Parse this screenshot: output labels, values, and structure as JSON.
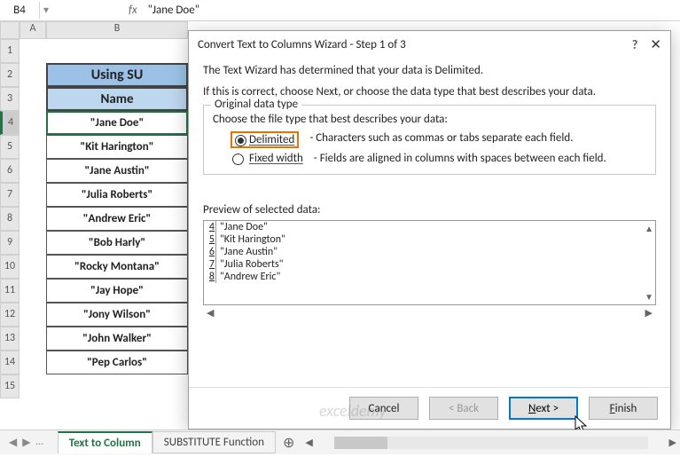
{
  "formula_bar": {
    "name_box": "B4",
    "dropdown_glyph": "▾",
    "fx_label": "fx",
    "formula_text": "\"Jane Doe\""
  },
  "columns": {
    "A": "A",
    "B": "B"
  },
  "rows": [
    "1",
    "2",
    "3",
    "4",
    "5",
    "6",
    "7",
    "8",
    "9",
    "10",
    "11",
    "12",
    "13",
    "14",
    "15"
  ],
  "table": {
    "title": "Using SU",
    "header": "Name",
    "data": [
      "\"Jane Doe\"",
      "\"Kit Harington\"",
      "\"Jane Austin\"",
      "\"Julia Roberts\"",
      "\"Andrew Eric\"",
      "\"Bob Harly\"",
      "\"Rocky Montana\"",
      "\"Jay Hope\"",
      "\"Jony Wilson\"",
      "\"John Walker\"",
      "\"Pep Carlos\""
    ]
  },
  "dialog": {
    "title": "Convert Text to Columns Wizard - Step 1 of 3",
    "help_glyph": "?",
    "close_glyph": "✕",
    "intro1": "The Text Wizard has determined that your data is Delimited.",
    "intro2": "If this is correct, choose Next, or choose the data type that best describes your data.",
    "fieldset_title": "Original data type",
    "choose_text": "Choose the file type that best describes your data:",
    "radio_delimited_label": "Delimited",
    "radio_delimited_desc": "- Characters such as commas or tabs separate each field.",
    "radio_fixed_label": "Fixed width",
    "radio_fixed_desc": "- Fields are aligned in columns with spaces between each field.",
    "preview_label": "Preview of selected data:",
    "preview_rows": [
      {
        "num": "4",
        "text": "\"Jane Doe\""
      },
      {
        "num": "5",
        "text": "\"Kit Harington\""
      },
      {
        "num": "6",
        "text": "\"Jane Austin\""
      },
      {
        "num": "7",
        "text": "\"Julia Roberts\""
      },
      {
        "num": "8",
        "text": "\"Andrew Eric\""
      }
    ],
    "scroll_up": "▲",
    "scroll_down": "▼",
    "hscroll_left": "◀",
    "hscroll_right": "▶",
    "buttons": {
      "cancel": "Cancel",
      "back": "< Back",
      "next_prefix": "N",
      "next_rest": "ext >",
      "finish_prefix": "F",
      "finish_rest": "inish"
    }
  },
  "tabs": {
    "nav_left": "◀",
    "nav_right": "▶",
    "ellipsis": "…",
    "active": "Text to Column",
    "other": "SUBSTITUTE Function",
    "add": "⊕"
  },
  "watermark": "exceldemy",
  "chart_data": {
    "type": "table",
    "title": "Using SU",
    "columns": [
      "Name"
    ],
    "rows": [
      [
        "\"Jane Doe\""
      ],
      [
        "\"Kit Harington\""
      ],
      [
        "\"Jane Austin\""
      ],
      [
        "\"Julia Roberts\""
      ],
      [
        "\"Andrew Eric\""
      ],
      [
        "\"Bob Harly\""
      ],
      [
        "\"Rocky Montana\""
      ],
      [
        "\"Jay Hope\""
      ],
      [
        "\"Jony Wilson\""
      ],
      [
        "\"John Walker\""
      ],
      [
        "\"Pep Carlos\""
      ]
    ]
  }
}
